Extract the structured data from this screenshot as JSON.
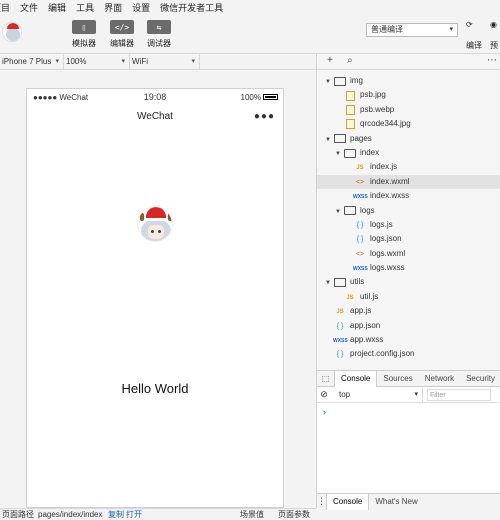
{
  "menu": [
    "项目",
    "文件",
    "编辑",
    "工具",
    "界面",
    "设置",
    "微信开发者工具"
  ],
  "toolbar": {
    "tools": [
      {
        "label": "模拟器",
        "glyph": "▯"
      },
      {
        "label": "编辑器",
        "glyph": "</>"
      },
      {
        "label": "调试器",
        "glyph": "⇆"
      }
    ],
    "compile_mode": "普通编译",
    "right_labels": [
      "编译",
      "预"
    ]
  },
  "device_bar": {
    "device": "iPhone 7 Plus",
    "zoom": "100%",
    "network": "WiFi"
  },
  "phone": {
    "carrier": "●●●●● WeChat",
    "time": "19:08",
    "battery": "100%",
    "nav_title": "WeChat",
    "nav_dots": "●●●",
    "greeting": "Hello World"
  },
  "file_tree": [
    {
      "name": "img",
      "type": "folder",
      "depth": 0,
      "expanded": true
    },
    {
      "name": "psb.jpg",
      "type": "img",
      "depth": 1
    },
    {
      "name": "psb.webp",
      "type": "img",
      "depth": 1
    },
    {
      "name": "qrcode344.jpg",
      "type": "img",
      "depth": 1
    },
    {
      "name": "pages",
      "type": "folder",
      "depth": 0,
      "expanded": true
    },
    {
      "name": "index",
      "type": "folder",
      "depth": 1,
      "expanded": true
    },
    {
      "name": "index.js",
      "type": "js",
      "depth": 2
    },
    {
      "name": "index.wxml",
      "type": "wxml",
      "depth": 2,
      "selected": true
    },
    {
      "name": "index.wxss",
      "type": "wxss",
      "depth": 2
    },
    {
      "name": "logs",
      "type": "folder",
      "depth": 1,
      "expanded": true
    },
    {
      "name": "logs.js",
      "type": "json",
      "depth": 2
    },
    {
      "name": "logs.json",
      "type": "json",
      "depth": 2
    },
    {
      "name": "logs.wxml",
      "type": "wxml",
      "depth": 2
    },
    {
      "name": "logs.wxss",
      "type": "wxss",
      "depth": 2
    },
    {
      "name": "utils",
      "type": "folder",
      "depth": 0,
      "expanded": true
    },
    {
      "name": "util.js",
      "type": "js",
      "depth": 1
    },
    {
      "name": "app.js",
      "type": "js",
      "depth": 0
    },
    {
      "name": "app.json",
      "type": "json",
      "depth": 0
    },
    {
      "name": "app.wxss",
      "type": "wxss",
      "depth": 0
    },
    {
      "name": "project.config.json",
      "type": "json",
      "depth": 0
    }
  ],
  "devtools": {
    "tabs": [
      "Console",
      "Sources",
      "Network",
      "Security"
    ],
    "context": "top",
    "filter_placeholder": "Filter",
    "prompt": "›",
    "bottom_tabs": [
      "Console",
      "What's New"
    ]
  },
  "statusbar": {
    "path_label": "页面路径",
    "path": "pages/index/index",
    "copy": "复制",
    "open": "打开",
    "scene": "场景值",
    "params": "页面参数"
  },
  "icons": {
    "folder": "folder-icon",
    "img": "image-file-icon",
    "js": "js-file-icon",
    "json": "json-file-icon",
    "wxml": "wxml-file-icon",
    "wxss": "wxss-file-icon"
  }
}
